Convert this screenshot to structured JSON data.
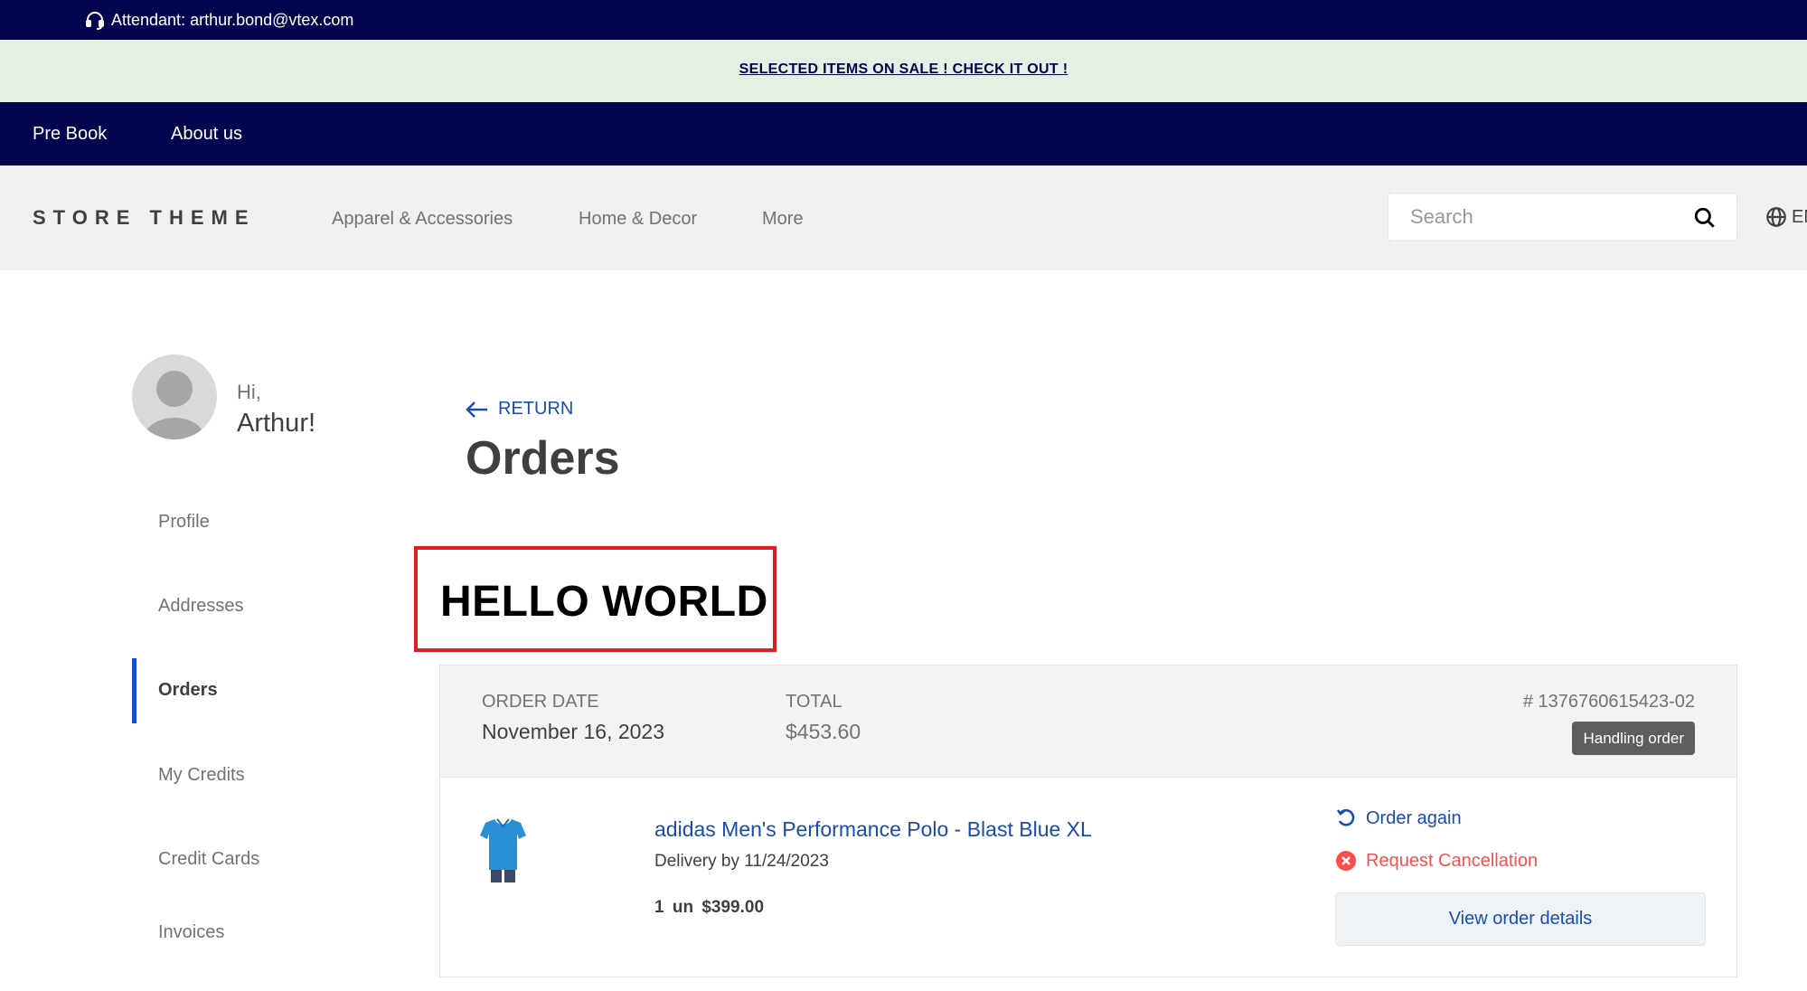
{
  "topbar": {
    "attendant": "Attendant: arthur.bond@vtex.com",
    "icon": "headset-icon"
  },
  "promo": {
    "text": "SELECTED ITEMS ON SALE ! CHECK IT OUT !"
  },
  "navbar": {
    "items": [
      {
        "label": "Pre Book"
      },
      {
        "label": "About us"
      }
    ]
  },
  "header": {
    "logo": "STORE THEME",
    "menu": [
      {
        "label": "Apparel & Accessories"
      },
      {
        "label": "Home & Decor"
      },
      {
        "label": "More"
      }
    ],
    "search": {
      "placeholder": "Search",
      "value": ""
    },
    "locale": "EN"
  },
  "profile": {
    "greeting": "Hi,",
    "name": "Arthur!"
  },
  "sidebar": {
    "items": [
      {
        "label": "Profile"
      },
      {
        "label": "Addresses"
      },
      {
        "label": "Orders",
        "active": true
      },
      {
        "label": "My Credits"
      },
      {
        "label": "Credit Cards"
      },
      {
        "label": "Invoices"
      }
    ]
  },
  "main": {
    "return_label": "RETURN",
    "title": "Orders",
    "highlight": "HELLO WORLD",
    "highlight_border_color": "#e31c23"
  },
  "order": {
    "date_label": "ORDER DATE",
    "date": "November 16, 2023",
    "total_label": "TOTAL",
    "total": "$453.60",
    "id": "# 1376760615423-02",
    "status": "Handling order",
    "item": {
      "name": "adidas Men's Performance Polo - Blast Blue XL",
      "delivery": "Delivery by 11/24/2023",
      "qty_price": "1 un  $399.00",
      "image": "blue-polo-shirt"
    },
    "actions": {
      "order_again": "Order again",
      "request_cancellation": "Request Cancellation",
      "view_details": "View order details"
    }
  },
  "colors": {
    "brand_navy": "#03044e",
    "promo_bg": "#e5f0e5",
    "link_blue": "#1a4bb0",
    "danger_red": "#ff4c4c",
    "active_indicator": "#134cd8"
  }
}
